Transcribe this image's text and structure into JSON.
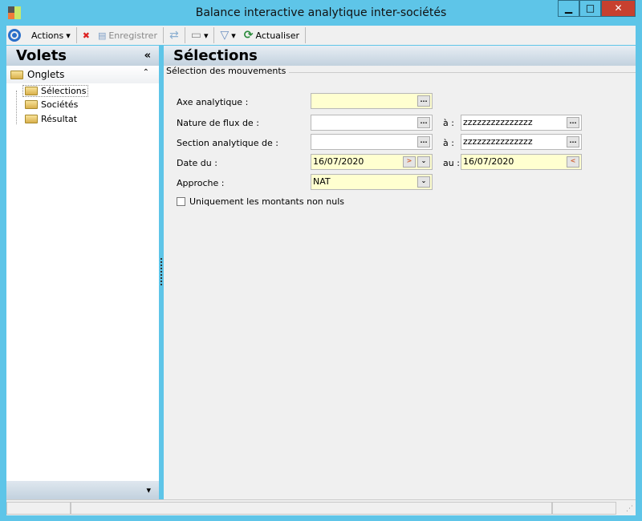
{
  "window": {
    "title": "Balance interactive analytique inter-sociétés",
    "minimize": "▁",
    "maximize": "□",
    "close": "✕"
  },
  "toolbar": {
    "actions": "Actions",
    "save": "Enregistrer",
    "refresh": "Actualiser"
  },
  "left_panel": {
    "title": "Volets",
    "collapse": "«",
    "group": "Onglets",
    "group_toggle": "⌃",
    "items": [
      {
        "label": "Sélections",
        "selected": true
      },
      {
        "label": "Sociétés"
      },
      {
        "label": "Résultat"
      }
    ],
    "bottom_arrow": "▾"
  },
  "main": {
    "title": "Sélections",
    "group_title": "Sélection des mouvements",
    "axe_label": "Axe analytique :",
    "axe_value": "",
    "nature_label": "Nature de flux de :",
    "nature_from": "",
    "nature_to_label": "à :",
    "nature_to": "zzzzzzzzzzzzzzz",
    "section_label": "Section analytique de :",
    "section_from": "",
    "section_to_label": "à :",
    "section_to": "zzzzzzzzzzzzzzz",
    "date_label": "Date du :",
    "date_from": "16/07/2020",
    "date_to_label": "au :",
    "date_to": "16/07/2020",
    "approche_label": "Approche :",
    "approche_value": "NAT",
    "nonzero_label": "Uniquement les montants non nuls",
    "nonzero_checked": false,
    "ellipsis": "..."
  }
}
